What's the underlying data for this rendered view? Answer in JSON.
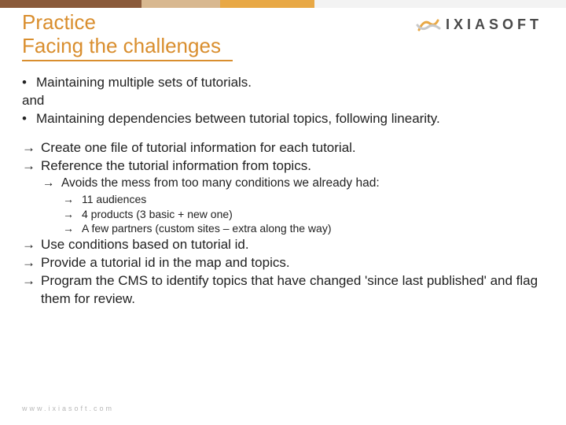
{
  "header": {
    "title_line1": "Practice",
    "title_line2": "Facing the challenges"
  },
  "logo": {
    "text": "IXIASOFT"
  },
  "bullets": {
    "b1": "Maintaining multiple sets of tutorials.",
    "and": "and",
    "b2": "Maintaining dependencies between tutorial topics, following linearity."
  },
  "arrows": {
    "a1": "Create one file of tutorial information for each tutorial.",
    "a2": "Reference the tutorial information from topics.",
    "a2_sub1": "Avoids the mess from too many conditions we already had:",
    "a2_sub1_items": {
      "i1": "11 audiences",
      "i2": "4 products (3 basic + new one)",
      "i3": "A few partners (custom sites – extra along the way)"
    },
    "a3": "Use conditions based on tutorial id.",
    "a4": "Provide a tutorial id in the map and topics.",
    "a5": "Program the CMS to identify topics that have changed 'since last published' and flag them for review."
  },
  "footer": {
    "url": "www.ixiasoft.com"
  },
  "glyphs": {
    "bullet": "•",
    "arrow": "→"
  }
}
